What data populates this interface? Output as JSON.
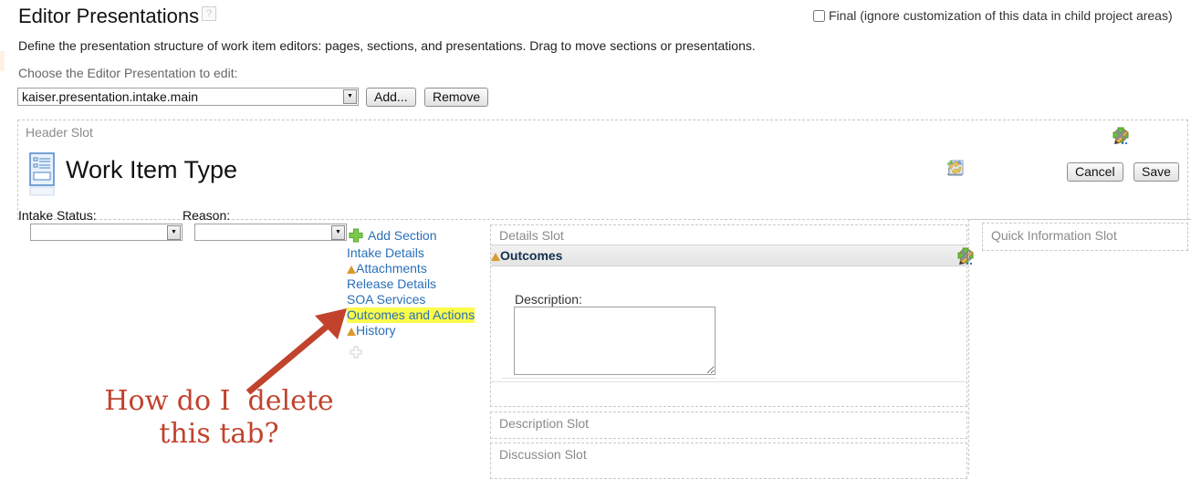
{
  "page": {
    "title": "Editor Presentations",
    "help_icon": "?",
    "final_checkbox": {
      "label": "Final (ignore customization of this data in child project areas)",
      "checked": false
    },
    "description": "Define the presentation structure of work item editors: pages, sections, and presentations. Drag to move sections or presentations.",
    "choose_label": "Choose the Editor Presentation to edit:",
    "presentation_select": {
      "value": "kaiser.presentation.intake.main"
    },
    "add_button": "Add...",
    "remove_button": "Remove"
  },
  "header_slot": {
    "label": "Header Slot",
    "title": "Work Item Type",
    "icons": [
      "add-icon",
      "edit-icon",
      "delete-icon"
    ],
    "toolbar_icons": [
      "find-related-icon",
      "add-subscriber-icon",
      "refresh-workspace-icon",
      "sync-icon"
    ],
    "cancel_button": "Cancel",
    "save_button": "Save",
    "fields": [
      {
        "label": "Intake Status:",
        "value": ""
      },
      {
        "label": "Reason:",
        "value": ""
      }
    ]
  },
  "sections": {
    "add_label": "Add Section",
    "items": [
      {
        "label": "Intake Details",
        "warning": false,
        "highlighted": false
      },
      {
        "label": "Attachments",
        "warning": true,
        "highlighted": false
      },
      {
        "label": "Release Details",
        "warning": false,
        "highlighted": false
      },
      {
        "label": "SOA Services",
        "warning": false,
        "highlighted": false
      },
      {
        "label": "Outcomes and Actions",
        "warning": false,
        "highlighted": true
      },
      {
        "label": "History",
        "warning": true,
        "highlighted": false
      }
    ]
  },
  "details_slot": {
    "label": "Details Slot",
    "presentation": {
      "title": "Outcomes",
      "warning": true
    },
    "field_label": "Description:",
    "field_value": ""
  },
  "other_slots": {
    "description": "Description Slot",
    "discussion": "Discussion Slot",
    "quick_info": "Quick Information Slot"
  },
  "annotation": {
    "line1": "How do I  delete",
    "line2": "this tab?",
    "color": "#c1432e"
  },
  "colors": {
    "link": "#2a6fb8",
    "highlight": "#fbfb4a",
    "slot_label": "#8a8a8a"
  }
}
